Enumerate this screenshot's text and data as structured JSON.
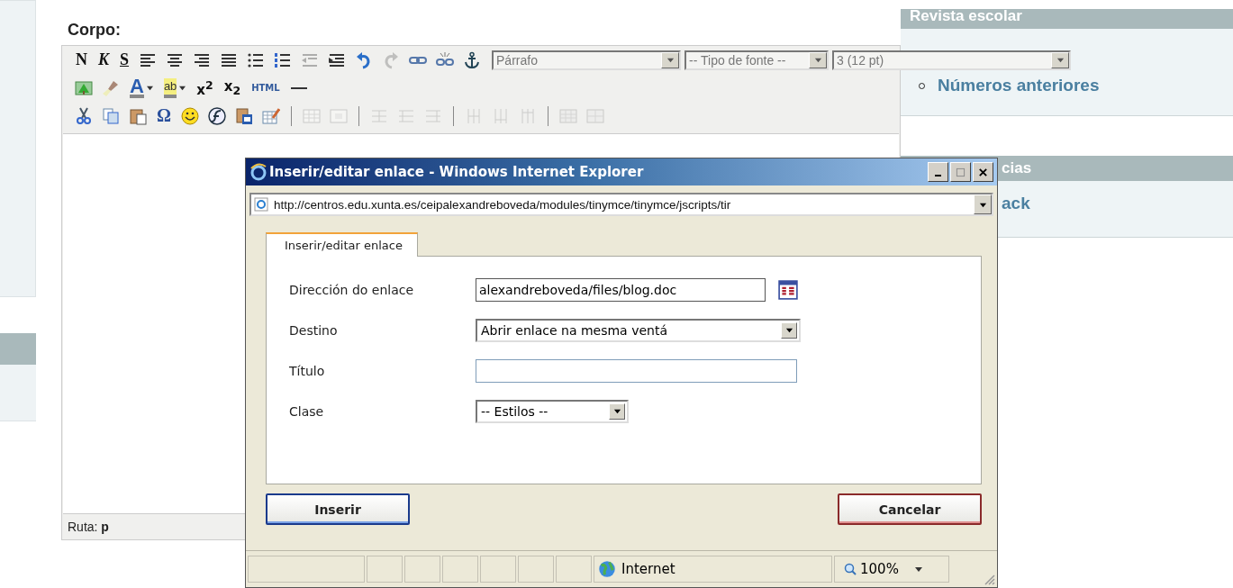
{
  "editor": {
    "label": "Corpo:",
    "toolbar_rows": [
      [
        {
          "kind": "bold",
          "label": "N",
          "disabled": false
        },
        {
          "kind": "italic",
          "label": "K",
          "disabled": false
        },
        {
          "kind": "underline",
          "label": "S",
          "disabled": false
        },
        {
          "kind": "icon",
          "disabled": false
        },
        {
          "kind": "icon",
          "disabled": false
        },
        {
          "kind": "icon",
          "disabled": false
        },
        {
          "kind": "icon",
          "disabled": false
        },
        {
          "kind": "icon",
          "disabled": false
        },
        {
          "kind": "icon",
          "disabled": false
        },
        {
          "kind": "icon",
          "disabled": true
        },
        {
          "kind": "icon",
          "disabled": false
        },
        {
          "kind": "icon",
          "disabled": false
        },
        {
          "kind": "icon",
          "disabled": true
        },
        {
          "kind": "icon",
          "disabled": false
        },
        {
          "kind": "icon",
          "disabled": false
        },
        {
          "kind": "icon",
          "disabled": false
        },
        {
          "kind": "select",
          "label": "Párrafo",
          "disabled": false
        },
        {
          "kind": "select",
          "label": "-- Tipo de fonte --",
          "disabled": false
        },
        {
          "kind": "select",
          "label": "3 (12 pt)",
          "disabled": false
        }
      ],
      [
        {
          "kind": "icon",
          "disabled": false
        },
        {
          "kind": "icon",
          "disabled": false
        },
        {
          "kind": "color-letter",
          "label": "A",
          "disabled": false
        },
        {
          "kind": "color-letter",
          "label": "ab",
          "disabled": false
        },
        {
          "kind": "script",
          "label": "x$^{2}$",
          "disabled": false
        },
        {
          "kind": "script",
          "label": "x$_{2}$",
          "disabled": false
        },
        {
          "kind": "small-text",
          "label": "HTML",
          "disabled": false
        },
        {
          "kind": "icon",
          "disabled": false
        }
      ],
      [
        {
          "kind": "icon",
          "disabled": false
        },
        {
          "kind": "icon",
          "disabled": false
        },
        {
          "kind": "icon",
          "disabled": false
        },
        {
          "kind": "symbol",
          "label": "Ω",
          "disabled": false
        },
        {
          "kind": "icon",
          "disabled": false
        },
        {
          "kind": "icon",
          "disabled": false
        },
        {
          "kind": "icon",
          "disabled": false
        },
        {
          "kind": "icon",
          "disabled": false
        },
        {
          "kind": "separator"
        },
        {
          "kind": "icon",
          "disabled": true
        },
        {
          "kind": "icon",
          "disabled": true
        },
        {
          "kind": "separator"
        },
        {
          "kind": "icon",
          "disabled": true
        },
        {
          "kind": "icon",
          "disabled": true
        },
        {
          "kind": "icon",
          "disabled": true
        },
        {
          "kind": "separator"
        },
        {
          "kind": "icon",
          "disabled": true
        },
        {
          "kind": "icon",
          "disabled": true
        },
        {
          "kind": "icon",
          "disabled": true
        },
        {
          "kind": "separator"
        },
        {
          "kind": "icon",
          "disabled": true
        },
        {
          "kind": "icon",
          "disabled": true
        }
      ]
    ],
    "path": "Ruta: **p**"
  },
  "sidebar": {
    "sections": [
      {
        "heading": "Revista escolar",
        "links": [
          {
            "label": "Números anteriores",
            "bullet": true
          }
        ]
      },
      {
        "heading": "cias",
        "links": [
          {
            "label": "ack",
            "bullet": false
          }
        ]
      }
    ]
  },
  "dialog": {
    "title": "Inserir/editar enlace - Windows Internet Explorer",
    "url": "http://centros.edu.xunta.es/ceipalexandreboveda/modules/tinymce/tinymce/jscripts/tir",
    "tabs": [
      {
        "label": "Inserir/editar enlace",
        "selected": true
      }
    ],
    "fields": [
      {
        "kind": "text",
        "label": "Dirección do enlace",
        "value": "alexandreboveda/files/blog.doc",
        "browse": true
      },
      {
        "kind": "select",
        "label": "Destino",
        "value": "Abrir enlace na mesma ventá"
      },
      {
        "kind": "text",
        "label": "Título"
      },
      {
        "kind": "select",
        "label": "Clase",
        "value": "-- Estilos --"
      }
    ],
    "buttons": [
      {
        "label": "Inserir",
        "kind": "primary"
      },
      {
        "label": "Cancelar",
        "kind": "cancel"
      }
    ],
    "status_bar": {
      "zone": "Internet",
      "zoom": "100%"
    }
  }
}
